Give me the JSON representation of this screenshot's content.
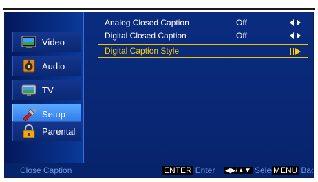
{
  "sidebar": {
    "items": [
      {
        "label": "Video",
        "icon": "video-icon",
        "active": false
      },
      {
        "label": "Audio",
        "icon": "audio-icon",
        "active": false
      },
      {
        "label": "TV",
        "icon": "tv-icon",
        "active": false
      },
      {
        "label": "Setup",
        "icon": "setup-icon",
        "active": true
      },
      {
        "label": "Parental",
        "icon": "parental-lock-icon",
        "active": false
      }
    ]
  },
  "menu": {
    "rows": [
      {
        "label": "Analog Closed Caption",
        "value": "Off",
        "control": "left-right-arrows-icon",
        "selected": false
      },
      {
        "label": "Digital Closed Caption",
        "value": "Off",
        "control": "left-right-arrows-icon",
        "selected": false
      },
      {
        "label": "Digital Caption Style",
        "value": "",
        "control": "enter-submenu-icon",
        "selected": true
      }
    ]
  },
  "status": {
    "title": "Close Caption",
    "enter_key": "ENTER",
    "enter_hint": "Enter",
    "select_key": "◀▶/▲▼",
    "select_hint": "Select",
    "menu_key": "MENU",
    "menu_hint": "Back"
  },
  "colors": {
    "background": "#06246b",
    "selected_text": "#ffcc00",
    "selected_border": "#f2c400",
    "active_tab": "#3b8cf5",
    "hint_text": "#6f94e0"
  }
}
